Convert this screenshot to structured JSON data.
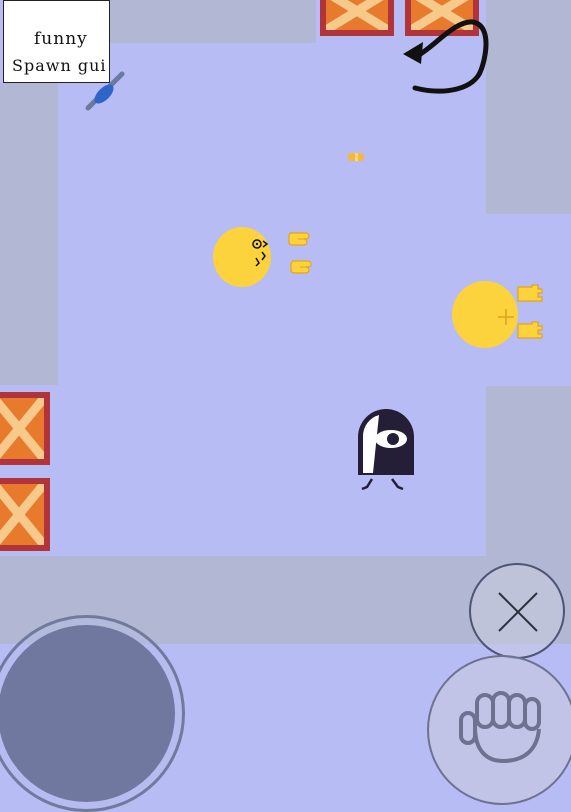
{
  "spawn_note": {
    "line1": "funny",
    "line2": "Spawn gui"
  },
  "colors": {
    "floor": "#b8bcf5",
    "wall": "#b2b8d4",
    "crate_fill": "#e87a2e",
    "crate_border": "#b0343a",
    "player_yellow": "#fcd33c",
    "ghost_dark": "#241f36"
  },
  "icons": {
    "rotate": "rotate-arrow-icon",
    "close": "x-icon",
    "grab": "fist-icon"
  },
  "controls": {
    "joystick": "movement-joystick",
    "cancel_button": "cancel-button",
    "grab_button": "grab-button"
  }
}
